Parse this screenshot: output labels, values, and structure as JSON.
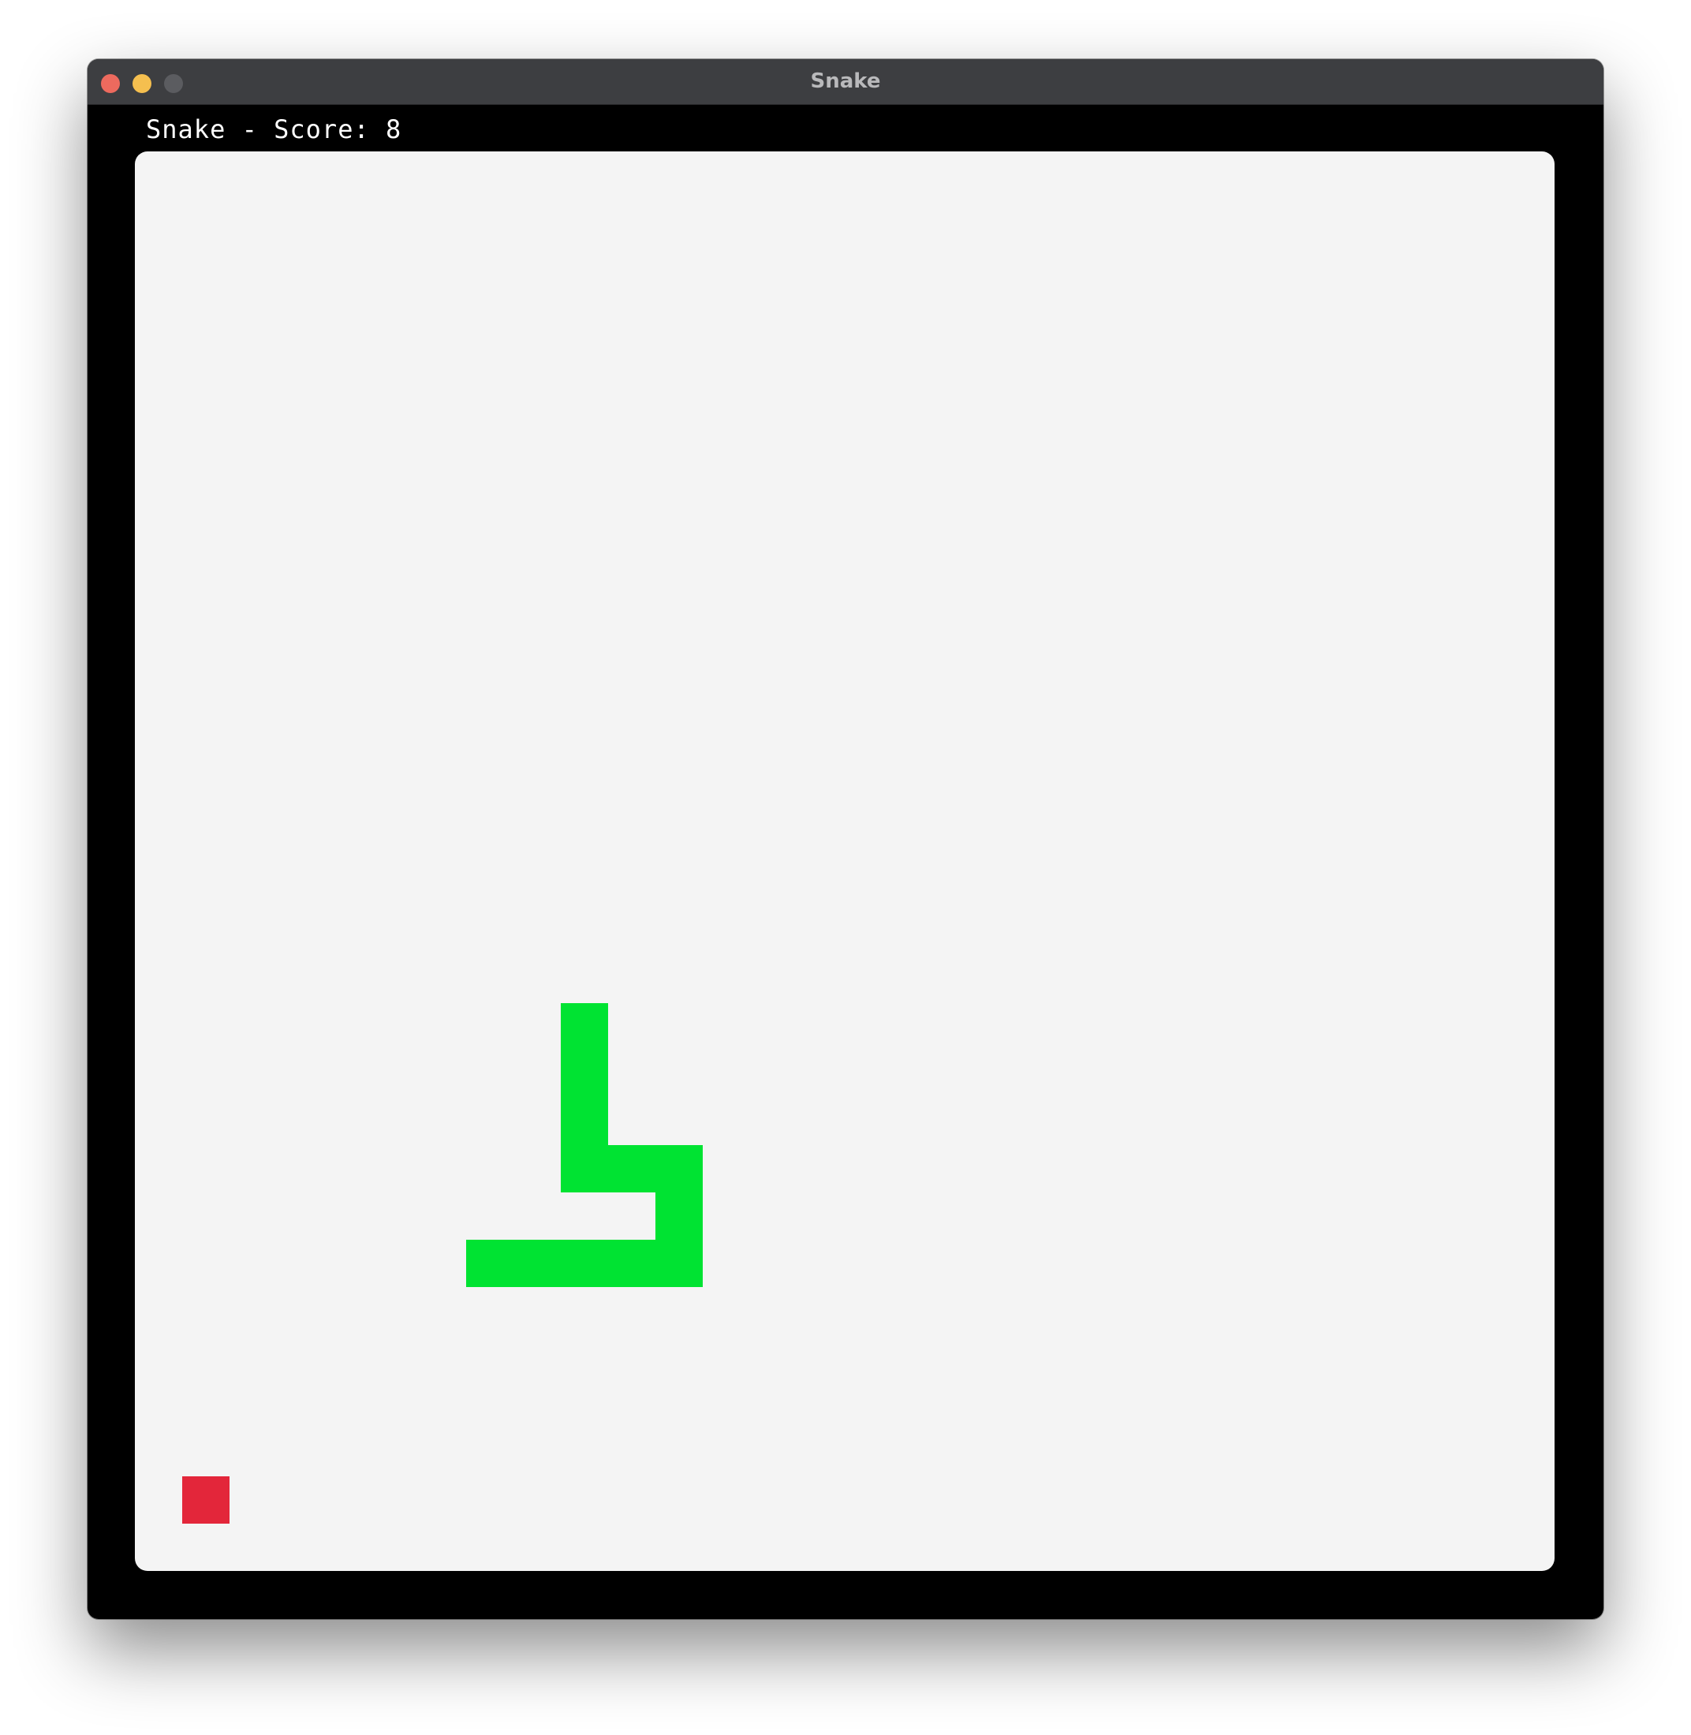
{
  "window": {
    "title": "Snake"
  },
  "game": {
    "score_label": "Snake - Score: 8",
    "grid_columns": 30,
    "grid_rows": 30,
    "colors": {
      "board": "#f4f4f4",
      "snake": "#00e332",
      "food": "#e3263a",
      "frame": "#000000"
    },
    "snake": [
      [
        7,
        6
      ],
      [
        8,
        6
      ],
      [
        9,
        6
      ],
      [
        10,
        6
      ],
      [
        11,
        6
      ],
      [
        11,
        7
      ],
      [
        11,
        8
      ],
      [
        10,
        8
      ],
      [
        9,
        8
      ],
      [
        9,
        9
      ],
      [
        9,
        10
      ],
      [
        9,
        11
      ]
    ],
    "food": [
      1,
      1
    ]
  }
}
